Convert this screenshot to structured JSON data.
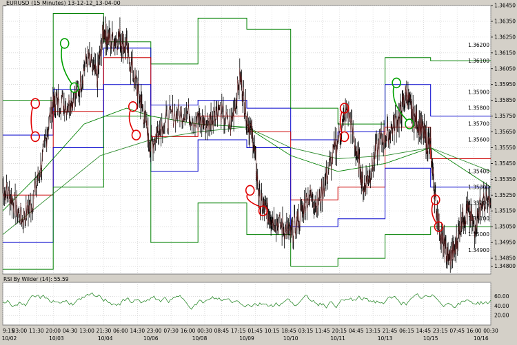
{
  "chart_data": {
    "type": "line",
    "title": "_EURUSD (15 Minutes) 13-12-12_13-04-00",
    "indicator_title": "RSI By Wilder (14): 55.59",
    "price_axis": {
      "min": 1.3475,
      "max": 1.3645,
      "ticks": [
        "1.36450",
        "1.36350",
        "1.36250",
        "1.36150",
        "1.36050",
        "1.35950",
        "1.35850",
        "1.35750",
        "1.35650",
        "1.35550",
        "1.35450",
        "1.35350",
        "1.35250",
        "1.35150",
        "1.35050",
        "1.34950",
        "1.34850",
        "1.34800"
      ],
      "tick_values": [
        1.3645,
        1.3635,
        1.3625,
        1.3615,
        1.3605,
        1.3595,
        1.3585,
        1.3575,
        1.3565,
        1.3555,
        1.3545,
        1.3535,
        1.3525,
        1.3515,
        1.3505,
        1.3495,
        1.3485,
        1.348
      ]
    },
    "inner_price_labels": [
      "1.36200",
      "1.36100",
      "1.35900",
      "1.35800",
      "1.35700",
      "1.35600",
      "1.35400",
      "1.35300",
      "1.35200",
      "1.35100",
      "1.35000",
      "1.34900"
    ],
    "inner_price_values": [
      1.362,
      1.361,
      1.359,
      1.358,
      1.357,
      1.356,
      1.354,
      1.353,
      1.352,
      1.351,
      1.35,
      1.349
    ],
    "rsi_axis": {
      "ticks": [
        "60.00",
        "40.00",
        "20.00"
      ],
      "tick_values": [
        60,
        40,
        20
      ],
      "min": 0,
      "max": 90
    },
    "time_labels": [
      "9:15",
      "03:00",
      "11:30",
      "20:00",
      "04:30",
      "13:00",
      "21:30",
      "06:00",
      "14:30",
      "23:00",
      "07:30",
      "16:00",
      "00:30",
      "08:45",
      "17:15",
      "01:45",
      "10:15",
      "18:45",
      "03:15",
      "11:45",
      "20:15",
      "04:45",
      "13:15",
      "21:45",
      "06:15",
      "14:45",
      "23:15",
      "07:45",
      "16:00",
      "00:30"
    ],
    "date_labels": [
      "10/02",
      "10/03",
      "10/04",
      "10/06",
      "10/08",
      "10/09",
      "10/10",
      "10/11",
      "10/13",
      "10/15",
      "10/16"
    ],
    "date_positions": [
      0.02,
      0.165,
      0.315,
      0.455,
      0.605,
      0.75,
      0.885,
      1.03,
      1.175,
      1.315,
      1.47
    ],
    "price_series": [
      [
        0,
        1.353
      ],
      [
        0.03,
        1.3522
      ],
      [
        0.06,
        1.351
      ],
      [
        0.09,
        1.352
      ],
      [
        0.12,
        1.3545
      ],
      [
        0.15,
        1.358
      ],
      [
        0.165,
        1.3585
      ],
      [
        0.2,
        1.3582
      ],
      [
        0.23,
        1.359
      ],
      [
        0.26,
        1.3612
      ],
      [
        0.29,
        1.3598
      ],
      [
        0.31,
        1.363
      ],
      [
        0.33,
        1.3622
      ],
      [
        0.36,
        1.3625
      ],
      [
        0.38,
        1.3618
      ],
      [
        0.41,
        1.3595
      ],
      [
        0.43,
        1.358
      ],
      [
        0.455,
        1.3555
      ],
      [
        0.48,
        1.3568
      ],
      [
        0.52,
        1.3575
      ],
      [
        0.56,
        1.3578
      ],
      [
        0.6,
        1.3572
      ],
      [
        0.63,
        1.357
      ],
      [
        0.66,
        1.358
      ],
      [
        0.7,
        1.3568
      ],
      [
        0.73,
        1.36
      ],
      [
        0.75,
        1.3575
      ],
      [
        0.77,
        1.356
      ],
      [
        0.79,
        1.352
      ],
      [
        0.81,
        1.3515
      ],
      [
        0.83,
        1.351
      ],
      [
        0.86,
        1.3505
      ],
      [
        0.885,
        1.35
      ],
      [
        0.91,
        1.351
      ],
      [
        0.94,
        1.3525
      ],
      [
        0.97,
        1.352
      ],
      [
        1.0,
        1.354
      ],
      [
        1.03,
        1.356
      ],
      [
        1.06,
        1.358
      ],
      [
        1.09,
        1.355
      ],
      [
        1.11,
        1.353
      ],
      [
        1.13,
        1.354
      ],
      [
        1.16,
        1.356
      ],
      [
        1.19,
        1.3565
      ],
      [
        1.22,
        1.3575
      ],
      [
        1.24,
        1.359
      ],
      [
        1.26,
        1.3575
      ],
      [
        1.28,
        1.357
      ],
      [
        1.3,
        1.356
      ],
      [
        1.315,
        1.3555
      ],
      [
        1.33,
        1.352
      ],
      [
        1.35,
        1.3495
      ],
      [
        1.37,
        1.3485
      ],
      [
        1.39,
        1.349
      ],
      [
        1.41,
        1.351
      ],
      [
        1.43,
        1.3515
      ],
      [
        1.45,
        1.3505
      ],
      [
        1.47,
        1.352
      ],
      [
        1.5,
        1.352
      ]
    ],
    "moving_averages": [
      {
        "color": "#008000",
        "points": [
          [
            0,
            1.3515
          ],
          [
            0.12,
            1.354
          ],
          [
            0.25,
            1.357
          ],
          [
            0.38,
            1.358
          ],
          [
            0.455,
            1.3575
          ],
          [
            0.6,
            1.357
          ],
          [
            0.75,
            1.3568
          ],
          [
            0.885,
            1.355
          ],
          [
            1.03,
            1.354
          ],
          [
            1.175,
            1.3545
          ],
          [
            1.315,
            1.3555
          ],
          [
            1.5,
            1.353
          ]
        ]
      },
      {
        "color": "#2e8b2e",
        "points": [
          [
            0,
            1.35
          ],
          [
            0.15,
            1.3525
          ],
          [
            0.3,
            1.355
          ],
          [
            0.455,
            1.356
          ],
          [
            0.6,
            1.3565
          ],
          [
            0.75,
            1.3568
          ],
          [
            0.885,
            1.3555
          ],
          [
            1.03,
            1.3548
          ],
          [
            1.175,
            1.355
          ],
          [
            1.315,
            1.3555
          ],
          [
            1.5,
            1.354
          ]
        ]
      }
    ],
    "pivot_lines": [
      {
        "color": "#008000",
        "points": [
          [
            0,
            1.3585
          ],
          [
            0.155,
            1.3585
          ],
          [
            0.155,
            1.364
          ],
          [
            0.31,
            1.364
          ],
          [
            0.31,
            1.3622
          ],
          [
            0.455,
            1.3622
          ],
          [
            0.455,
            1.3608
          ],
          [
            0.6,
            1.3608
          ],
          [
            0.6,
            1.3637
          ],
          [
            0.75,
            1.3637
          ],
          [
            0.75,
            1.363
          ],
          [
            0.885,
            1.363
          ],
          [
            0.885,
            1.358
          ],
          [
            1.03,
            1.358
          ],
          [
            1.03,
            1.357
          ],
          [
            1.175,
            1.357
          ],
          [
            1.175,
            1.3612
          ],
          [
            1.315,
            1.3612
          ],
          [
            1.315,
            1.361
          ],
          [
            1.5,
            1.361
          ]
        ]
      },
      {
        "color": "#0000cc",
        "points": [
          [
            0,
            1.3563
          ],
          [
            0.155,
            1.3563
          ],
          [
            0.155,
            1.3592
          ],
          [
            0.31,
            1.3592
          ],
          [
            0.31,
            1.3618
          ],
          [
            0.455,
            1.3618
          ],
          [
            0.455,
            1.3582
          ],
          [
            0.6,
            1.3582
          ],
          [
            0.6,
            1.3585
          ],
          [
            0.75,
            1.3585
          ],
          [
            0.75,
            1.358
          ],
          [
            0.885,
            1.358
          ],
          [
            0.885,
            1.356
          ],
          [
            1.03,
            1.356
          ],
          [
            1.03,
            1.3565
          ],
          [
            1.175,
            1.3565
          ],
          [
            1.175,
            1.3595
          ],
          [
            1.315,
            1.3595
          ],
          [
            1.315,
            1.3575
          ],
          [
            1.5,
            1.3575
          ]
        ]
      },
      {
        "color": "#cc0000",
        "points": [
          [
            0,
            1.3525
          ],
          [
            0.155,
            1.3525
          ],
          [
            0.155,
            1.3578
          ],
          [
            0.31,
            1.3578
          ],
          [
            0.31,
            1.3612
          ],
          [
            0.455,
            1.3612
          ],
          [
            0.455,
            1.3562
          ],
          [
            0.6,
            1.3562
          ],
          [
            0.6,
            1.3575
          ],
          [
            0.75,
            1.3575
          ],
          [
            0.75,
            1.3565
          ],
          [
            0.885,
            1.3565
          ],
          [
            0.885,
            1.3522
          ],
          [
            1.03,
            1.3522
          ],
          [
            1.03,
            1.353
          ],
          [
            1.175,
            1.353
          ],
          [
            1.175,
            1.3568
          ],
          [
            1.315,
            1.3568
          ],
          [
            1.315,
            1.3548
          ],
          [
            1.5,
            1.3548
          ]
        ]
      },
      {
        "color": "#0000cc",
        "points": [
          [
            0,
            1.3495
          ],
          [
            0.155,
            1.3495
          ],
          [
            0.155,
            1.3555
          ],
          [
            0.31,
            1.3555
          ],
          [
            0.31,
            1.3595
          ],
          [
            0.455,
            1.3595
          ],
          [
            0.455,
            1.354
          ],
          [
            0.6,
            1.354
          ],
          [
            0.6,
            1.356
          ],
          [
            0.75,
            1.356
          ],
          [
            0.75,
            1.3555
          ],
          [
            0.885,
            1.3555
          ],
          [
            0.885,
            1.3505
          ],
          [
            1.03,
            1.3505
          ],
          [
            1.03,
            1.351
          ],
          [
            1.175,
            1.351
          ],
          [
            1.175,
            1.3542
          ],
          [
            1.315,
            1.3542
          ],
          [
            1.315,
            1.353
          ],
          [
            1.5,
            1.353
          ]
        ]
      },
      {
        "color": "#008000",
        "points": [
          [
            0,
            1.3478
          ],
          [
            0.155,
            1.3478
          ],
          [
            0.155,
            1.353
          ],
          [
            0.31,
            1.353
          ],
          [
            0.31,
            1.3575
          ],
          [
            0.455,
            1.3575
          ],
          [
            0.455,
            1.3495
          ],
          [
            0.6,
            1.3495
          ],
          [
            0.6,
            1.352
          ],
          [
            0.75,
            1.352
          ],
          [
            0.75,
            1.35
          ],
          [
            0.885,
            1.35
          ],
          [
            0.885,
            1.348
          ],
          [
            1.03,
            1.348
          ],
          [
            1.03,
            1.3485
          ],
          [
            1.175,
            1.3485
          ],
          [
            1.175,
            1.35
          ],
          [
            1.315,
            1.35
          ],
          [
            1.315,
            1.3505
          ],
          [
            1.5,
            1.3505
          ]
        ]
      }
    ],
    "annotations": [
      {
        "shape": "circle",
        "color": "#e00000",
        "x": 0.1,
        "y": 1.3583
      },
      {
        "shape": "circle",
        "color": "#e00000",
        "x": 0.1,
        "y": 1.3562
      },
      {
        "shape": "circle",
        "color": "#00a000",
        "x": 0.19,
        "y": 1.3621
      },
      {
        "shape": "circle",
        "color": "#00a000",
        "x": 0.22,
        "y": 1.3593
      },
      {
        "shape": "circle",
        "color": "#e00000",
        "x": 0.4,
        "y": 1.3581
      },
      {
        "shape": "circle",
        "color": "#e00000",
        "x": 0.41,
        "y": 1.3563
      },
      {
        "shape": "circle",
        "color": "#e00000",
        "x": 0.76,
        "y": 1.3528
      },
      {
        "shape": "circle",
        "color": "#e00000",
        "x": 0.8,
        "y": 1.3515
      },
      {
        "shape": "circle",
        "color": "#e00000",
        "x": 1.05,
        "y": 1.358
      },
      {
        "shape": "circle",
        "color": "#e00000",
        "x": 1.05,
        "y": 1.3562
      },
      {
        "shape": "circle",
        "color": "#00a000",
        "x": 1.21,
        "y": 1.3596
      },
      {
        "shape": "circle",
        "color": "#00a000",
        "x": 1.25,
        "y": 1.357
      },
      {
        "shape": "circle",
        "color": "#e00000",
        "x": 1.33,
        "y": 1.3522
      },
      {
        "shape": "circle",
        "color": "#e00000",
        "x": 1.34,
        "y": 1.3505
      }
    ],
    "rsi_series_seed": 55.59
  }
}
